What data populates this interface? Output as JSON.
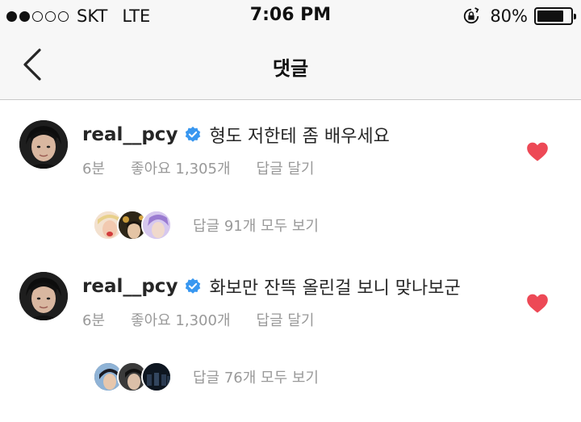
{
  "status_bar": {
    "carrier": "SKT",
    "network": "LTE",
    "time": "7:06 PM",
    "battery": "80%",
    "battery_level": 0.8,
    "signal_bars_filled": 2,
    "signal_bars_total": 5
  },
  "nav": {
    "title": "댓글",
    "back_icon": "chevron-left-icon"
  },
  "comments": [
    {
      "username": "real__pcy",
      "verified": true,
      "text": "형도 저한테 좀 배우세요",
      "time": "6분",
      "likes": "좋아요 1,305개",
      "reply_label": "답글 달기",
      "liked": true,
      "replies_label": "답글 91개 모두 보기"
    },
    {
      "username": "real__pcy",
      "verified": true,
      "text": "화보만 잔뜩 올린걸 보니 맞나보군",
      "time": "6분",
      "likes": "좋아요 1,300개",
      "reply_label": "답글 달기",
      "liked": true,
      "replies_label": "답글 76개 모두 보기"
    }
  ],
  "colors": {
    "heart": "#ed4956",
    "verified": "#3897f0",
    "meta_text": "#999999"
  }
}
